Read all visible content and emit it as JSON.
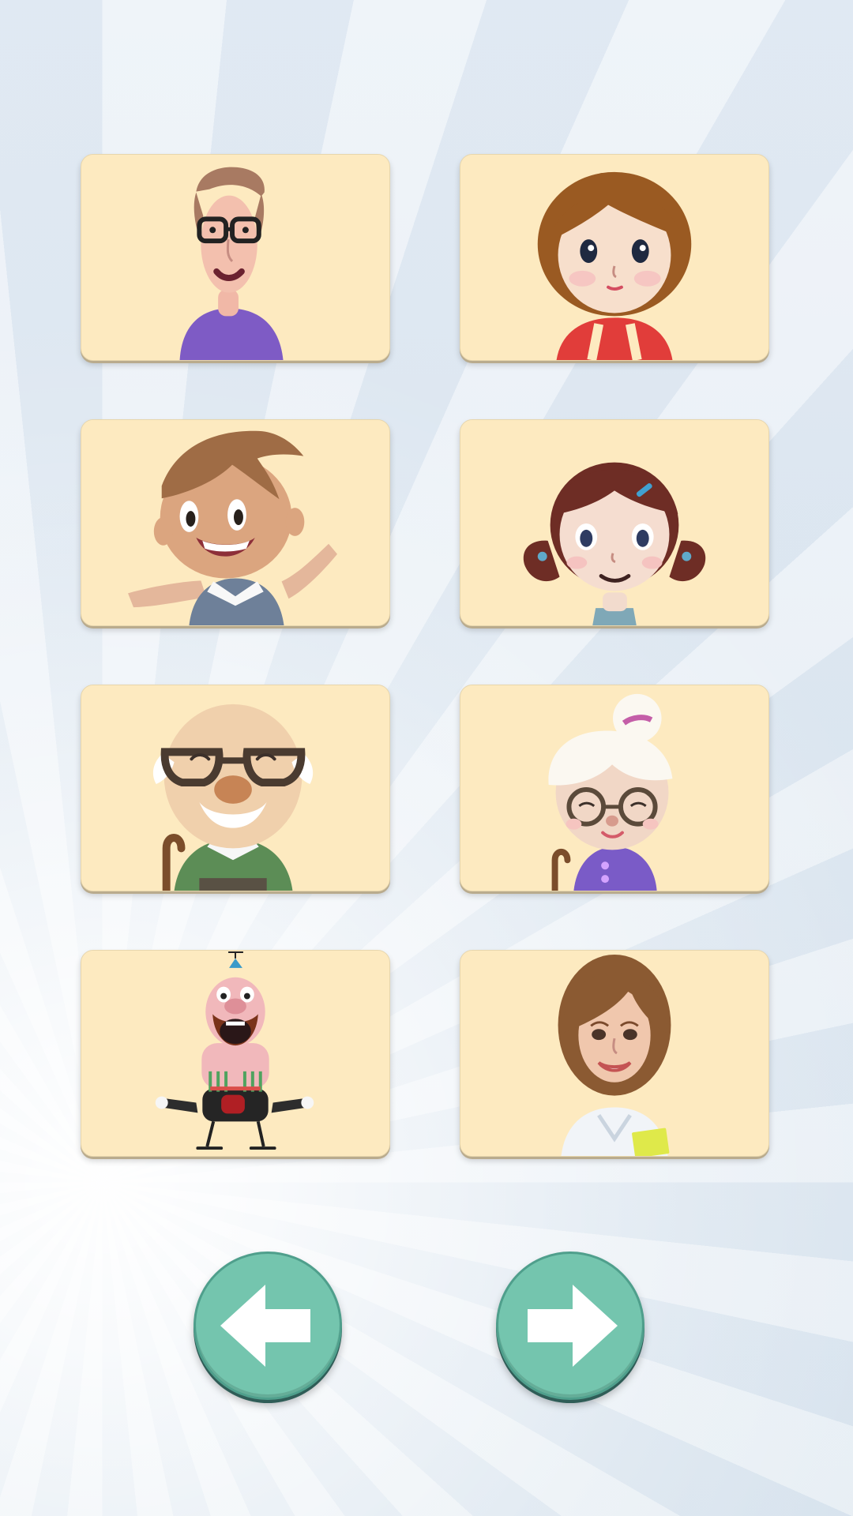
{
  "screen": {
    "accent": "#74c5ae",
    "card_color": "#fdeac0",
    "background_color": "#dfe8f1"
  },
  "cards": [
    {
      "icon": "man-with-glasses-icon"
    },
    {
      "icon": "woman-brown-hair-icon"
    },
    {
      "icon": "boy-waving-icon"
    },
    {
      "icon": "girl-pigtails-icon"
    },
    {
      "icon": "grandfather-icon"
    },
    {
      "icon": "grandmother-icon"
    },
    {
      "icon": "uncle-cartoon-icon"
    },
    {
      "icon": "teacher-icon"
    }
  ],
  "navigation": {
    "previous_icon": "arrow-left-icon",
    "next_icon": "arrow-right-icon"
  }
}
